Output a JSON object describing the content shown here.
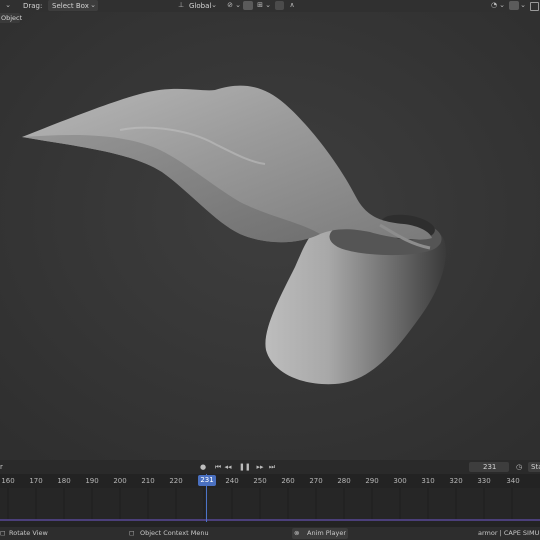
{
  "header": {
    "drag_label": "Drag:",
    "drag_value": "Select Box",
    "orientation": "Global"
  },
  "viewport": {
    "mode_label": "Object"
  },
  "timeline": {
    "left_label": "r",
    "current_frame": "231",
    "end_label": "Sta",
    "ticks": [
      "160",
      "170",
      "180",
      "190",
      "200",
      "210",
      "220",
      "230",
      "240",
      "250",
      "260",
      "270",
      "280",
      "290",
      "300",
      "310",
      "320",
      "330",
      "340"
    ]
  },
  "statusbar": {
    "rotate": "Rotate View",
    "context": "Object Context Menu",
    "anim_player": "Anim Player",
    "scene_info": "armor | CAPE SIMULAT"
  },
  "colors": {
    "accent": "#4a70c0",
    "viewport_bg": "#393939"
  }
}
